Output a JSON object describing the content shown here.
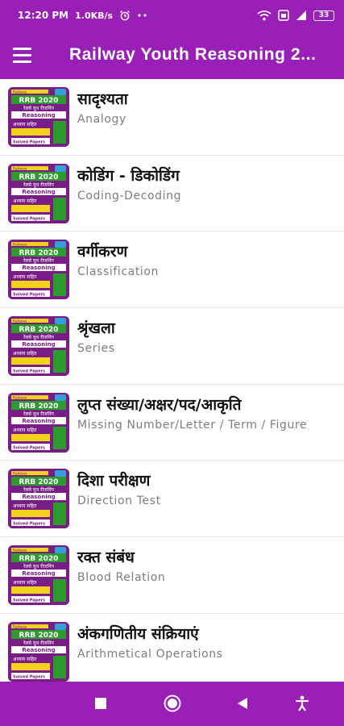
{
  "status_bar": {
    "time": "12:20 PM",
    "speed": "1.0KB/s",
    "battery": "33"
  },
  "app_bar": {
    "title": "Railway Youth Reasoning 2..."
  },
  "thumbnail": {
    "top_text": "Railway",
    "badge": "RRB 2020",
    "subtitle": "रेलवे यूथ रीजनिंग",
    "subject": "Reasoning",
    "hindi_text": "अध्याय सहित",
    "footer": "Solved Papers"
  },
  "items": [
    {
      "hindi": "सादृश्यता",
      "english": "Analogy"
    },
    {
      "hindi": "कोडिंग - डिकोडिंग",
      "english": "Coding-Decoding"
    },
    {
      "hindi": "वर्गीकरण",
      "english": "Classification"
    },
    {
      "hindi": "श्रृंखला",
      "english": "Series"
    },
    {
      "hindi": "लुप्त संख्या/अक्षर/पद/आकृति",
      "english": "Missing Number/Letter / Term / Figure"
    },
    {
      "hindi": "दिशा परीक्षण",
      "english": "Direction Test"
    },
    {
      "hindi": "रक्त संबंध",
      "english": "Blood Relation"
    },
    {
      "hindi": "अंकगणितीय संक्रियाएं",
      "english": "Arithmetical Operations"
    }
  ],
  "colors": {
    "primary": "#9a1fb6",
    "thumb_bg": "#7a1c86",
    "thumb_badge": "#2e9b2e",
    "thumb_accent": "#f3d21b"
  }
}
